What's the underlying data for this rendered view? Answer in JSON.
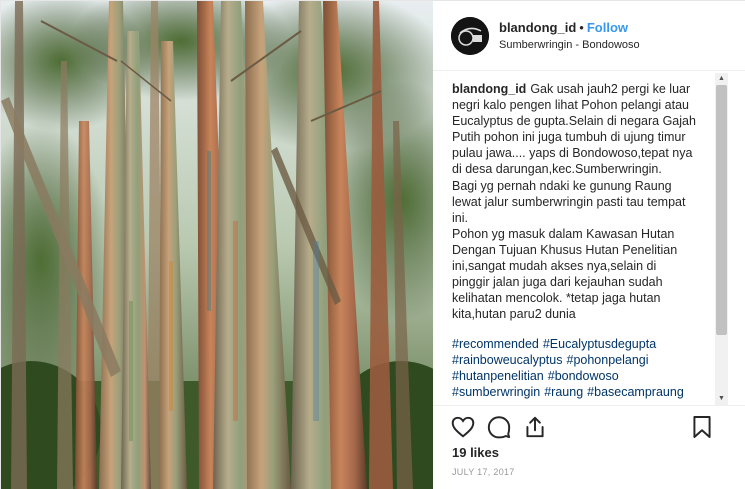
{
  "post": {
    "username": "blandong_id",
    "separator": "•",
    "follow_label": "Follow",
    "location": "Sumberwringin - Bondowoso",
    "caption_username": "blandong_id",
    "caption_lines": [
      "Gak usah jauh2 pergi ke luar",
      "negri kalo pengen lihat Pohon pelangi atau",
      "Eucalyptus de gupta.Selain di negara Gajah",
      "Putih pohon ini juga tumbuh di ujung timur",
      "pulau jawa.... yaps di Bondowoso,tepat nya",
      "di desa darungan,kec.Sumberwringin.",
      "Bagi yg pernah ndaki ke gunung Raung",
      "lewat jalur sumberwringin pasti tau tempat",
      "ini.",
      "Pohon yg masuk dalam Kawasan Hutan",
      "Dengan Tujuan Khusus Hutan Penelitian",
      "ini,sangat mudah akses nya,selain di",
      "pinggir jalan juga dari kejauhan sudah",
      "kelihatan mencolok. *tetap jaga hutan",
      "kita,hutan paru2 dunia"
    ],
    "hashtag_lines": [
      [
        "#recommended",
        "#Eucalyptusdegupta"
      ],
      [
        "#rainboweucalyptus",
        "#pohonpelangi"
      ],
      [
        "#hutanpenelitian",
        "#bondowoso"
      ],
      [
        "#sumberwringin",
        "#raung",
        "#basecampraung"
      ]
    ],
    "likes": "19 likes",
    "date": "JULY 17, 2017"
  },
  "icons": {
    "like": "heart-icon",
    "comment": "comment-icon",
    "share": "share-icon",
    "save": "bookmark-icon",
    "scroll_up": "▲",
    "scroll_down": "▼"
  },
  "colors": {
    "follow": "#3897f0",
    "hashtag": "#003569",
    "text": "#262626",
    "muted": "#999999"
  }
}
